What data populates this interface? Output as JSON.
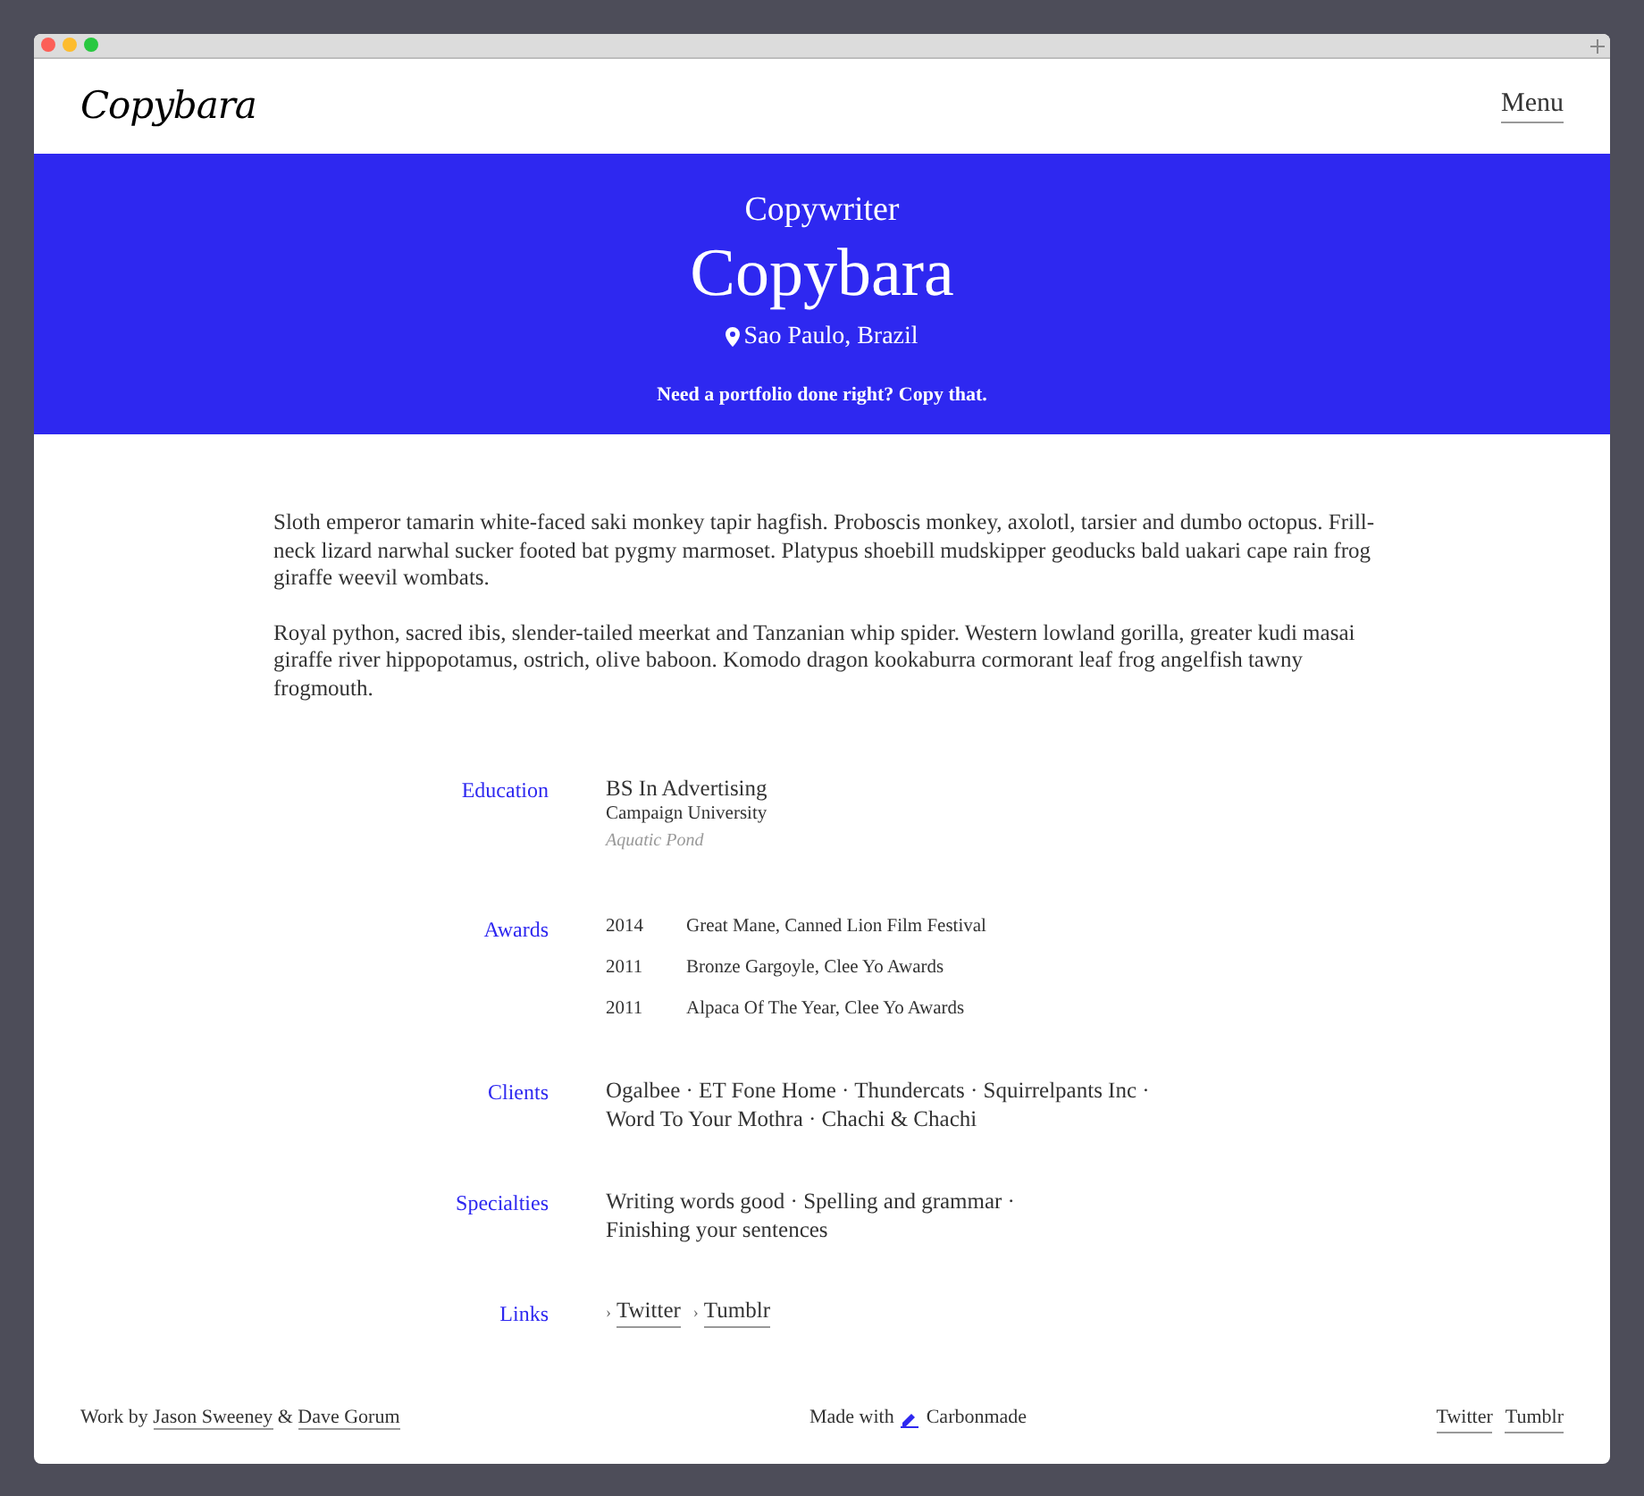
{
  "header": {
    "logo": "Copybara",
    "menu": "Menu"
  },
  "hero": {
    "role": "Copywriter",
    "name": "Copybara",
    "location": "Sao Paulo, Brazil",
    "tagline": "Need a portfolio done right? Copy that."
  },
  "about": [
    "Sloth emperor tamarin white-faced saki monkey tapir hagfish. Proboscis monkey, axolotl, tarsier and dumbo octopus. Frill-neck lizard narwhal sucker footed bat pygmy marmoset. Platypus shoebill mudskipper geoducks bald uakari cape rain frog giraffe weevil wombats.",
    "Royal python, sacred ibis, slender-tailed meerkat and Tanzanian whip spider. Western lowland gorilla, greater kudi masai giraffe river hippopotamus, ostrich, olive baboon. Komodo dragon kookaburra cormorant leaf frog angelfish tawny frogmouth."
  ],
  "sections": [
    {
      "kind": "education",
      "label": "Education",
      "degree": "BS In Advertising",
      "school": "Campaign University",
      "place": "Aquatic Pond"
    },
    {
      "kind": "awards",
      "label": "Awards",
      "items": [
        {
          "year": "2014",
          "title": "Great Mane, Canned Lion Film Festival"
        },
        {
          "year": "2011",
          "title": "Bronze Gargoyle, Clee Yo Awards"
        },
        {
          "year": "2011",
          "title": "Alpaca Of The Year, Clee Yo Awards"
        }
      ]
    },
    {
      "kind": "lines",
      "label": "Clients",
      "lines": [
        "Ogalbee · ET Fone Home · Thundercats · Squirrelpants Inc ·",
        "Word To Your Mothra · Chachi & Chachi"
      ]
    },
    {
      "kind": "lines",
      "label": "Specialties",
      "lines": [
        "Writing words good · Spelling and grammar ·",
        "Finishing your sentences"
      ]
    },
    {
      "kind": "links",
      "label": "Links",
      "items": [
        {
          "marker": "›",
          "text": "Twitter"
        },
        {
          "marker": "›",
          "text": "Tumblr"
        }
      ]
    }
  ],
  "footer": {
    "credits": {
      "prefix": "Work by",
      "authors": [
        "Jason Sweeney",
        "Dave Gorum"
      ],
      "joiner": "&"
    },
    "made_with": "Made with",
    "brand": "Carbonmade",
    "links": [
      "Twitter",
      "Tumblr"
    ]
  }
}
